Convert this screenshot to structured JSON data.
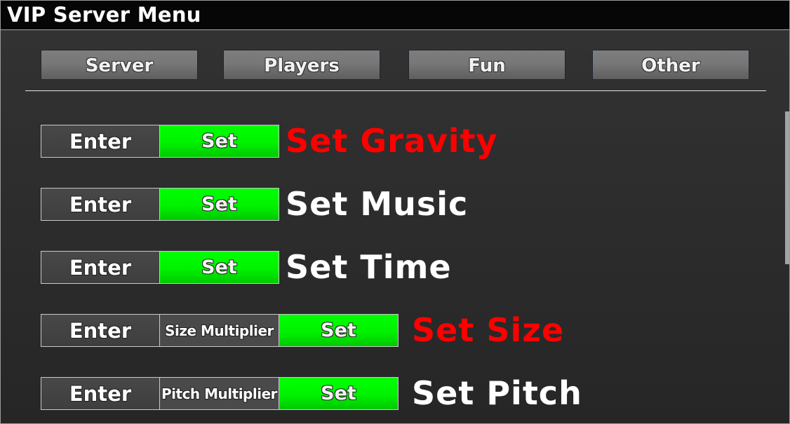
{
  "window": {
    "title": "VIP Server Menu"
  },
  "tabs": [
    {
      "label": "Server"
    },
    {
      "label": "Players"
    },
    {
      "label": "Fun"
    },
    {
      "label": "Other"
    }
  ],
  "colors": {
    "accent_green": "#00ff00",
    "warning_red": "#ff0000",
    "text_white": "#ffffff"
  },
  "rows": [
    {
      "input_placeholder": "Enter",
      "set_label": "Set",
      "heading": "Set Gravity",
      "heading_color": "#ff0000"
    },
    {
      "input_placeholder": "Enter",
      "set_label": "Set",
      "heading": "Set Music",
      "heading_color": "#ffffff"
    },
    {
      "input_placeholder": "Enter",
      "set_label": "Set",
      "heading": "Set Time",
      "heading_color": "#ffffff"
    },
    {
      "input_placeholder": "Enter",
      "multiplier_label": "Size Multiplier",
      "set_label": "Set",
      "heading": "Set Size",
      "heading_color": "#ff0000"
    },
    {
      "input_placeholder": "Enter",
      "multiplier_label": "Pitch Multiplier",
      "set_label": "Set",
      "heading": "Set Pitch",
      "heading_color": "#ffffff"
    }
  ]
}
